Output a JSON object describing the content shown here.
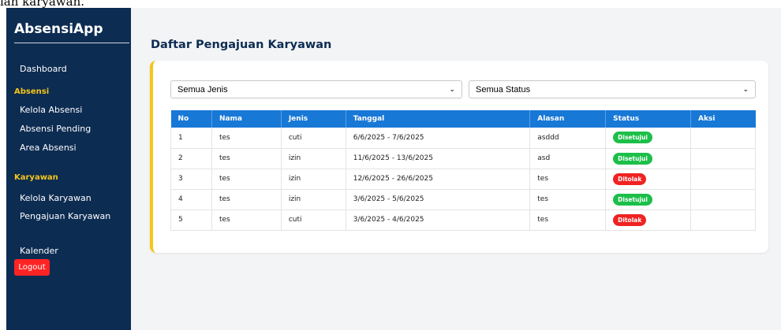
{
  "top_fragment": "ian karyawan.",
  "sidebar": {
    "brand": "AbsensiApp",
    "items": [
      {
        "type": "link",
        "label": "Dashboard"
      },
      {
        "type": "section",
        "label": "Absensi"
      },
      {
        "type": "link",
        "label": "Kelola Absensi"
      },
      {
        "type": "link",
        "label": "Absensi Pending"
      },
      {
        "type": "link",
        "label": "Area Absensi"
      },
      {
        "type": "section",
        "label": "Karyawan"
      },
      {
        "type": "link",
        "label": "Kelola Karyawan"
      },
      {
        "type": "link",
        "label": "Pengajuan Karyawan"
      },
      {
        "type": "link",
        "label": "Kalender"
      }
    ],
    "logout_label": "Logout"
  },
  "main": {
    "title": "Daftar Pengajuan Karyawan",
    "filters": {
      "jenis": "Semua Jenis",
      "status": "Semua Status"
    },
    "table": {
      "columns": [
        "No",
        "Nama",
        "Jenis",
        "Tanggal",
        "Alasan",
        "Status",
        "Aksi"
      ],
      "rows": [
        {
          "no": "1",
          "nama": "tes",
          "jenis": "cuti",
          "tanggal": "6/6/2025 - 7/6/2025",
          "alasan": "asddd",
          "status": "Disetujui",
          "status_kind": "approved"
        },
        {
          "no": "2",
          "nama": "tes",
          "jenis": "izin",
          "tanggal": "11/6/2025 - 13/6/2025",
          "alasan": "asd",
          "status": "Disetujui",
          "status_kind": "approved"
        },
        {
          "no": "3",
          "nama": "tes",
          "jenis": "izin",
          "tanggal": "12/6/2025 - 26/6/2025",
          "alasan": "tes",
          "status": "Ditolak",
          "status_kind": "rejected"
        },
        {
          "no": "4",
          "nama": "tes",
          "jenis": "izin",
          "tanggal": "3/6/2025 - 5/6/2025",
          "alasan": "tes",
          "status": "Disetujui",
          "status_kind": "approved"
        },
        {
          "no": "5",
          "nama": "tes",
          "jenis": "cuti",
          "tanggal": "3/6/2025 - 4/6/2025",
          "alasan": "tes",
          "status": "Ditolak",
          "status_kind": "rejected"
        }
      ]
    }
  },
  "colors": {
    "sidebar_bg": "#0d2c52",
    "accent_yellow": "#f5c518",
    "table_header": "#1878d6",
    "approved": "#1cbf49",
    "rejected": "#f02222",
    "logout": "#ff2424"
  }
}
